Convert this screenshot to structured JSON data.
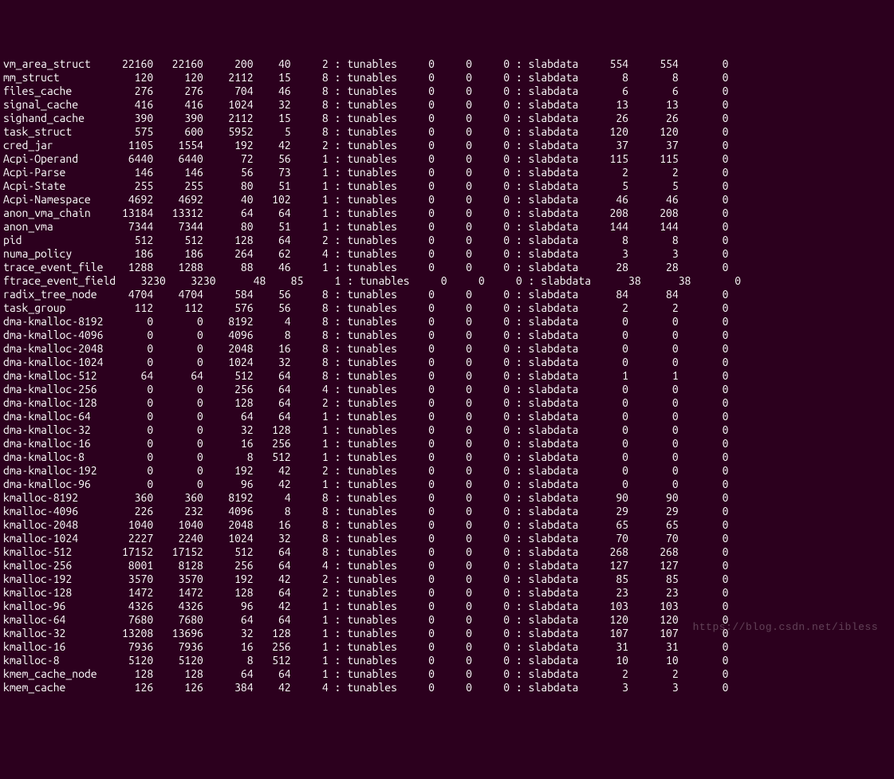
{
  "watermark": "https://blog.csdn.net/ibless",
  "tun_label": "tunables",
  "slab_label": "slabdata",
  "rows": [
    {
      "name": "vm_area_struct",
      "active": 22160,
      "num": 22160,
      "objsize": 200,
      "objper": 40,
      "pps": 2,
      "t0": 0,
      "t1": 0,
      "t2": 0,
      "s0": 554,
      "s1": 554,
      "s2": 0
    },
    {
      "name": "mm_struct",
      "active": 120,
      "num": 120,
      "objsize": 2112,
      "objper": 15,
      "pps": 8,
      "t0": 0,
      "t1": 0,
      "t2": 0,
      "s0": 8,
      "s1": 8,
      "s2": 0
    },
    {
      "name": "files_cache",
      "active": 276,
      "num": 276,
      "objsize": 704,
      "objper": 46,
      "pps": 8,
      "t0": 0,
      "t1": 0,
      "t2": 0,
      "s0": 6,
      "s1": 6,
      "s2": 0
    },
    {
      "name": "signal_cache",
      "active": 416,
      "num": 416,
      "objsize": 1024,
      "objper": 32,
      "pps": 8,
      "t0": 0,
      "t1": 0,
      "t2": 0,
      "s0": 13,
      "s1": 13,
      "s2": 0
    },
    {
      "name": "sighand_cache",
      "active": 390,
      "num": 390,
      "objsize": 2112,
      "objper": 15,
      "pps": 8,
      "t0": 0,
      "t1": 0,
      "t2": 0,
      "s0": 26,
      "s1": 26,
      "s2": 0
    },
    {
      "name": "task_struct",
      "active": 575,
      "num": 600,
      "objsize": 5952,
      "objper": 5,
      "pps": 8,
      "t0": 0,
      "t1": 0,
      "t2": 0,
      "s0": 120,
      "s1": 120,
      "s2": 0
    },
    {
      "name": "cred_jar",
      "active": 1105,
      "num": 1554,
      "objsize": 192,
      "objper": 42,
      "pps": 2,
      "t0": 0,
      "t1": 0,
      "t2": 0,
      "s0": 37,
      "s1": 37,
      "s2": 0
    },
    {
      "name": "Acpi-Operand",
      "active": 6440,
      "num": 6440,
      "objsize": 72,
      "objper": 56,
      "pps": 1,
      "t0": 0,
      "t1": 0,
      "t2": 0,
      "s0": 115,
      "s1": 115,
      "s2": 0
    },
    {
      "name": "Acpi-Parse",
      "active": 146,
      "num": 146,
      "objsize": 56,
      "objper": 73,
      "pps": 1,
      "t0": 0,
      "t1": 0,
      "t2": 0,
      "s0": 2,
      "s1": 2,
      "s2": 0
    },
    {
      "name": "Acpi-State",
      "active": 255,
      "num": 255,
      "objsize": 80,
      "objper": 51,
      "pps": 1,
      "t0": 0,
      "t1": 0,
      "t2": 0,
      "s0": 5,
      "s1": 5,
      "s2": 0
    },
    {
      "name": "Acpi-Namespace",
      "active": 4692,
      "num": 4692,
      "objsize": 40,
      "objper": 102,
      "pps": 1,
      "t0": 0,
      "t1": 0,
      "t2": 0,
      "s0": 46,
      "s1": 46,
      "s2": 0
    },
    {
      "name": "anon_vma_chain",
      "active": 13184,
      "num": 13312,
      "objsize": 64,
      "objper": 64,
      "pps": 1,
      "t0": 0,
      "t1": 0,
      "t2": 0,
      "s0": 208,
      "s1": 208,
      "s2": 0
    },
    {
      "name": "anon_vma",
      "active": 7344,
      "num": 7344,
      "objsize": 80,
      "objper": 51,
      "pps": 1,
      "t0": 0,
      "t1": 0,
      "t2": 0,
      "s0": 144,
      "s1": 144,
      "s2": 0
    },
    {
      "name": "pid",
      "active": 512,
      "num": 512,
      "objsize": 128,
      "objper": 64,
      "pps": 2,
      "t0": 0,
      "t1": 0,
      "t2": 0,
      "s0": 8,
      "s1": 8,
      "s2": 0
    },
    {
      "name": "numa_policy",
      "active": 186,
      "num": 186,
      "objsize": 264,
      "objper": 62,
      "pps": 4,
      "t0": 0,
      "t1": 0,
      "t2": 0,
      "s0": 3,
      "s1": 3,
      "s2": 0
    },
    {
      "name": "trace_event_file",
      "active": 1288,
      "num": 1288,
      "objsize": 88,
      "objper": 46,
      "pps": 1,
      "t0": 0,
      "t1": 0,
      "t2": 0,
      "s0": 28,
      "s1": 28,
      "s2": 0
    },
    {
      "name": "ftrace_event_field",
      "active": 3230,
      "num": 3230,
      "objsize": 48,
      "objper": 85,
      "pps": 1,
      "t0": 0,
      "t1": 0,
      "t2": 0,
      "s0": 38,
      "s1": 38,
      "s2": 0,
      "wide": true
    },
    {
      "name": "radix_tree_node",
      "active": 4704,
      "num": 4704,
      "objsize": 584,
      "objper": 56,
      "pps": 8,
      "t0": 0,
      "t1": 0,
      "t2": 0,
      "s0": 84,
      "s1": 84,
      "s2": 0
    },
    {
      "name": "task_group",
      "active": 112,
      "num": 112,
      "objsize": 576,
      "objper": 56,
      "pps": 8,
      "t0": 0,
      "t1": 0,
      "t2": 0,
      "s0": 2,
      "s1": 2,
      "s2": 0
    },
    {
      "name": "dma-kmalloc-8192",
      "active": 0,
      "num": 0,
      "objsize": 8192,
      "objper": 4,
      "pps": 8,
      "t0": 0,
      "t1": 0,
      "t2": 0,
      "s0": 0,
      "s1": 0,
      "s2": 0
    },
    {
      "name": "dma-kmalloc-4096",
      "active": 0,
      "num": 0,
      "objsize": 4096,
      "objper": 8,
      "pps": 8,
      "t0": 0,
      "t1": 0,
      "t2": 0,
      "s0": 0,
      "s1": 0,
      "s2": 0
    },
    {
      "name": "dma-kmalloc-2048",
      "active": 0,
      "num": 0,
      "objsize": 2048,
      "objper": 16,
      "pps": 8,
      "t0": 0,
      "t1": 0,
      "t2": 0,
      "s0": 0,
      "s1": 0,
      "s2": 0
    },
    {
      "name": "dma-kmalloc-1024",
      "active": 0,
      "num": 0,
      "objsize": 1024,
      "objper": 32,
      "pps": 8,
      "t0": 0,
      "t1": 0,
      "t2": 0,
      "s0": 0,
      "s1": 0,
      "s2": 0
    },
    {
      "name": "dma-kmalloc-512",
      "active": 64,
      "num": 64,
      "objsize": 512,
      "objper": 64,
      "pps": 8,
      "t0": 0,
      "t1": 0,
      "t2": 0,
      "s0": 1,
      "s1": 1,
      "s2": 0
    },
    {
      "name": "dma-kmalloc-256",
      "active": 0,
      "num": 0,
      "objsize": 256,
      "objper": 64,
      "pps": 4,
      "t0": 0,
      "t1": 0,
      "t2": 0,
      "s0": 0,
      "s1": 0,
      "s2": 0
    },
    {
      "name": "dma-kmalloc-128",
      "active": 0,
      "num": 0,
      "objsize": 128,
      "objper": 64,
      "pps": 2,
      "t0": 0,
      "t1": 0,
      "t2": 0,
      "s0": 0,
      "s1": 0,
      "s2": 0
    },
    {
      "name": "dma-kmalloc-64",
      "active": 0,
      "num": 0,
      "objsize": 64,
      "objper": 64,
      "pps": 1,
      "t0": 0,
      "t1": 0,
      "t2": 0,
      "s0": 0,
      "s1": 0,
      "s2": 0
    },
    {
      "name": "dma-kmalloc-32",
      "active": 0,
      "num": 0,
      "objsize": 32,
      "objper": 128,
      "pps": 1,
      "t0": 0,
      "t1": 0,
      "t2": 0,
      "s0": 0,
      "s1": 0,
      "s2": 0
    },
    {
      "name": "dma-kmalloc-16",
      "active": 0,
      "num": 0,
      "objsize": 16,
      "objper": 256,
      "pps": 1,
      "t0": 0,
      "t1": 0,
      "t2": 0,
      "s0": 0,
      "s1": 0,
      "s2": 0
    },
    {
      "name": "dma-kmalloc-8",
      "active": 0,
      "num": 0,
      "objsize": 8,
      "objper": 512,
      "pps": 1,
      "t0": 0,
      "t1": 0,
      "t2": 0,
      "s0": 0,
      "s1": 0,
      "s2": 0
    },
    {
      "name": "dma-kmalloc-192",
      "active": 0,
      "num": 0,
      "objsize": 192,
      "objper": 42,
      "pps": 2,
      "t0": 0,
      "t1": 0,
      "t2": 0,
      "s0": 0,
      "s1": 0,
      "s2": 0
    },
    {
      "name": "dma-kmalloc-96",
      "active": 0,
      "num": 0,
      "objsize": 96,
      "objper": 42,
      "pps": 1,
      "t0": 0,
      "t1": 0,
      "t2": 0,
      "s0": 0,
      "s1": 0,
      "s2": 0
    },
    {
      "name": "kmalloc-8192",
      "active": 360,
      "num": 360,
      "objsize": 8192,
      "objper": 4,
      "pps": 8,
      "t0": 0,
      "t1": 0,
      "t2": 0,
      "s0": 90,
      "s1": 90,
      "s2": 0
    },
    {
      "name": "kmalloc-4096",
      "active": 226,
      "num": 232,
      "objsize": 4096,
      "objper": 8,
      "pps": 8,
      "t0": 0,
      "t1": 0,
      "t2": 0,
      "s0": 29,
      "s1": 29,
      "s2": 0
    },
    {
      "name": "kmalloc-2048",
      "active": 1040,
      "num": 1040,
      "objsize": 2048,
      "objper": 16,
      "pps": 8,
      "t0": 0,
      "t1": 0,
      "t2": 0,
      "s0": 65,
      "s1": 65,
      "s2": 0
    },
    {
      "name": "kmalloc-1024",
      "active": 2227,
      "num": 2240,
      "objsize": 1024,
      "objper": 32,
      "pps": 8,
      "t0": 0,
      "t1": 0,
      "t2": 0,
      "s0": 70,
      "s1": 70,
      "s2": 0
    },
    {
      "name": "kmalloc-512",
      "active": 17152,
      "num": 17152,
      "objsize": 512,
      "objper": 64,
      "pps": 8,
      "t0": 0,
      "t1": 0,
      "t2": 0,
      "s0": 268,
      "s1": 268,
      "s2": 0
    },
    {
      "name": "kmalloc-256",
      "active": 8001,
      "num": 8128,
      "objsize": 256,
      "objper": 64,
      "pps": 4,
      "t0": 0,
      "t1": 0,
      "t2": 0,
      "s0": 127,
      "s1": 127,
      "s2": 0
    },
    {
      "name": "kmalloc-192",
      "active": 3570,
      "num": 3570,
      "objsize": 192,
      "objper": 42,
      "pps": 2,
      "t0": 0,
      "t1": 0,
      "t2": 0,
      "s0": 85,
      "s1": 85,
      "s2": 0
    },
    {
      "name": "kmalloc-128",
      "active": 1472,
      "num": 1472,
      "objsize": 128,
      "objper": 64,
      "pps": 2,
      "t0": 0,
      "t1": 0,
      "t2": 0,
      "s0": 23,
      "s1": 23,
      "s2": 0
    },
    {
      "name": "kmalloc-96",
      "active": 4326,
      "num": 4326,
      "objsize": 96,
      "objper": 42,
      "pps": 1,
      "t0": 0,
      "t1": 0,
      "t2": 0,
      "s0": 103,
      "s1": 103,
      "s2": 0
    },
    {
      "name": "kmalloc-64",
      "active": 7680,
      "num": 7680,
      "objsize": 64,
      "objper": 64,
      "pps": 1,
      "t0": 0,
      "t1": 0,
      "t2": 0,
      "s0": 120,
      "s1": 120,
      "s2": 0
    },
    {
      "name": "kmalloc-32",
      "active": 13208,
      "num": 13696,
      "objsize": 32,
      "objper": 128,
      "pps": 1,
      "t0": 0,
      "t1": 0,
      "t2": 0,
      "s0": 107,
      "s1": 107,
      "s2": 0
    },
    {
      "name": "kmalloc-16",
      "active": 7936,
      "num": 7936,
      "objsize": 16,
      "objper": 256,
      "pps": 1,
      "t0": 0,
      "t1": 0,
      "t2": 0,
      "s0": 31,
      "s1": 31,
      "s2": 0
    },
    {
      "name": "kmalloc-8",
      "active": 5120,
      "num": 5120,
      "objsize": 8,
      "objper": 512,
      "pps": 1,
      "t0": 0,
      "t1": 0,
      "t2": 0,
      "s0": 10,
      "s1": 10,
      "s2": 0
    },
    {
      "name": "kmem_cache_node",
      "active": 128,
      "num": 128,
      "objsize": 64,
      "objper": 64,
      "pps": 1,
      "t0": 0,
      "t1": 0,
      "t2": 0,
      "s0": 2,
      "s1": 2,
      "s2": 0
    },
    {
      "name": "kmem_cache",
      "active": 126,
      "num": 126,
      "objsize": 384,
      "objper": 42,
      "pps": 4,
      "t0": 0,
      "t1": 0,
      "t2": 0,
      "s0": 3,
      "s1": 3,
      "s2": 0
    }
  ]
}
